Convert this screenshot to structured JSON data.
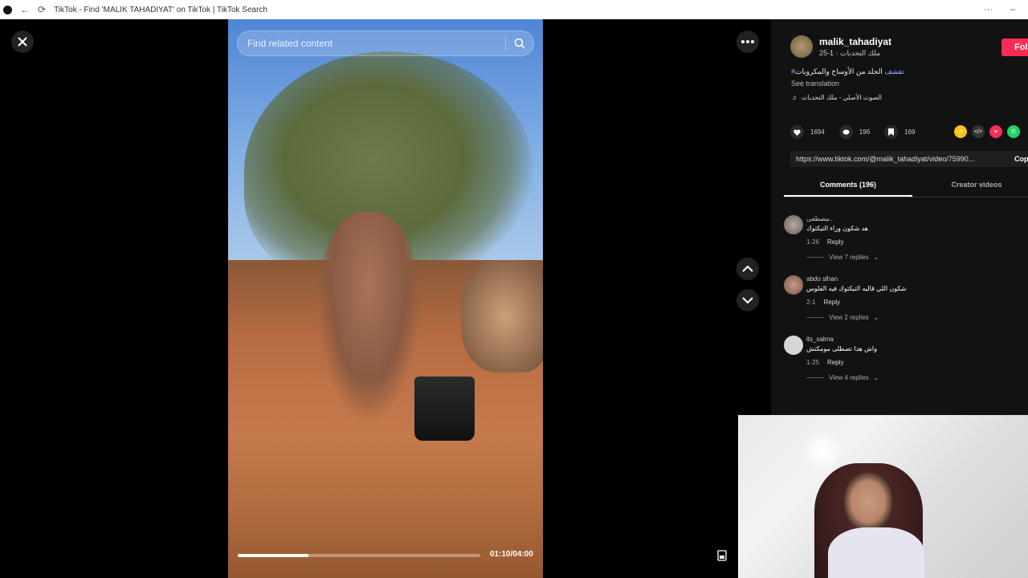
{
  "browser": {
    "tab_title": "TikTok - Find 'MALIK TAHADIYAT' on TikTok | TikTok Search",
    "menu_label": "···",
    "minimize_label": "–"
  },
  "video": {
    "search_placeholder": "Find related content",
    "time": "01:10/04:00",
    "progress": 0.29
  },
  "post": {
    "username": "malik_tahadiyat",
    "subtitle": "ملك التحديات · 1-25",
    "follow_label": "Fol",
    "hashtag": "#تقشف",
    "description": "الجلد من الأوساخ والمكروبات",
    "see_translation": "See translation",
    "music": "الصوت الأصلي - ملك التحديات"
  },
  "stats": {
    "likes": "1694",
    "comments": "196",
    "saves": "169"
  },
  "share": {
    "url": "https://www.tiktok.com/@malik_tahadiyat/video/75990...",
    "copy_label": "Copy"
  },
  "tabs": [
    {
      "label": "Comments (196)"
    },
    {
      "label": "Creator videos"
    }
  ],
  "comments": [
    {
      "name": "مصطفى..",
      "text": "هد شكون وراء التيكتوك",
      "date": "1-26",
      "reply": "Reply",
      "replies": "View 7 replies"
    },
    {
      "name": "abdo slhan",
      "text": "شكون اللي قاليه التيكتوك فيه الفلوس",
      "date": "2-1",
      "reply": "Reply",
      "replies": "View 2 replies"
    },
    {
      "name": "its_salma",
      "text": "واش هدا تصطلى مومكتش",
      "date": "1-25",
      "reply": "Reply",
      "replies": "View 4 replies"
    }
  ],
  "colors": {
    "follow": "#fe2c55",
    "hashtag": "#8ab4f8",
    "panel_bg": "#121212"
  }
}
